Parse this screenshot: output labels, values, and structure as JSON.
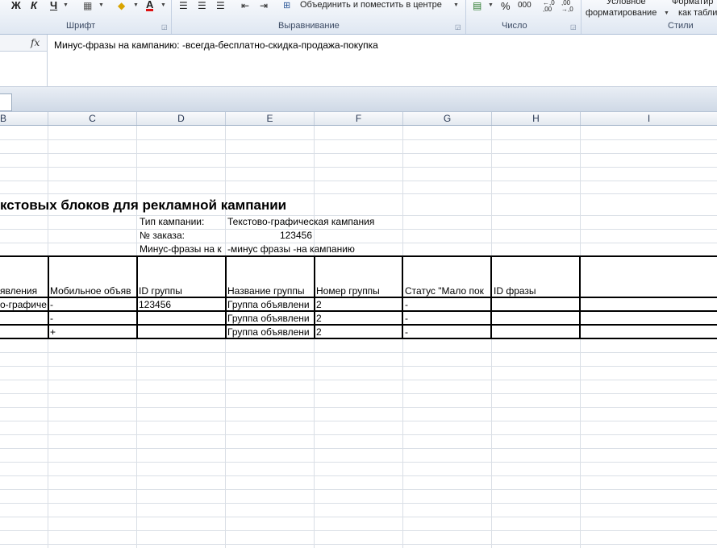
{
  "ribbon": {
    "font_group": "Шрифт",
    "align_group": "Выравнивание",
    "number_group": "Число",
    "styles_group": "Стили",
    "bold": "Ж",
    "italic": "К",
    "underline": "Ч",
    "font_color_letter": "A",
    "merge_center": "Объединить и поместить в центре",
    "percent": "%",
    "thousands": "000",
    "inc_decimal": "←,0\n,00",
    "cond_format_1": "Условное",
    "cond_format_2": "форматирование",
    "format_table_1": "Форматир",
    "format_table_2": "как табли",
    "accent_color": "#dfe7f2"
  },
  "formula_bar": {
    "fx_label": "fx",
    "content": "Минус-фразы на кампанию: -всегда-бесплатно-скидка-продажа-покупка"
  },
  "columns": [
    "B",
    "C",
    "D",
    "E",
    "F",
    "G",
    "H",
    "I"
  ],
  "sheet": {
    "title": "кстовых блоков для рекламной кампании",
    "campaign_type_label": "Тип кампании:",
    "campaign_type_value": "Текстово-графическая кампания",
    "order_label": "№ заказа:",
    "order_value": "123456",
    "minus_label": "Минус-фразы на к",
    "minus_value": "-минус фразы -на кампанию",
    "headers": {
      "b": "явления",
      "c": "Мобильное объяв",
      "d": "ID группы",
      "e": "Название группы",
      "f": "Номер группы",
      "g": "Статус \"Мало пок",
      "h": "ID фразы"
    },
    "rows": [
      {
        "b": "о-графиче",
        "c": "-",
        "d": "123456",
        "e": "Группа объявлени",
        "f": "2",
        "g": "-"
      },
      {
        "b": "",
        "c": "-",
        "d": "",
        "e": "Группа объявлени",
        "f": "2",
        "g": "-"
      },
      {
        "b": "",
        "c": "+",
        "d": "",
        "e": "Группа объявлени",
        "f": "2",
        "g": "-"
      }
    ]
  }
}
